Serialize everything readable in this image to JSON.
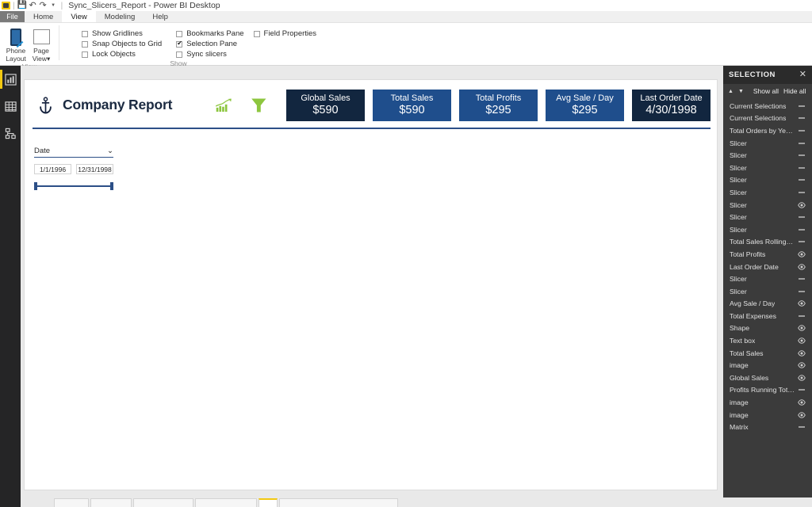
{
  "titlebar": {
    "logo_icon": "powerbi-logo-icon",
    "save_icon": "save-disk-icon",
    "undo_icon": "undo-arrow-icon",
    "redo_icon": "redo-arrow-icon",
    "caret_icon": "chevron-down-icon",
    "separator": "|",
    "title": "Sync_Slicers_Report - Power BI Desktop"
  },
  "ribbon": {
    "tabs": [
      {
        "label": "File",
        "active": false
      },
      {
        "label": "Home",
        "active": false
      },
      {
        "label": "View",
        "active": true
      },
      {
        "label": "Modeling",
        "active": false
      },
      {
        "label": "Help",
        "active": false
      }
    ],
    "groups": [
      {
        "label": "View"
      },
      {
        "label": "Show"
      }
    ],
    "buttons": [
      {
        "label_line1": "Phone",
        "label_line2": "Layout",
        "icon": "phone-layout-icon"
      },
      {
        "label_line1": "Page",
        "label_line2": "View",
        "icon": "page-view-icon",
        "caret": "▾"
      }
    ],
    "checkboxes": [
      {
        "label": "Show Gridlines",
        "checked": false
      },
      {
        "label": "Snap Objects to Grid",
        "checked": false
      },
      {
        "label": "Lock Objects",
        "checked": false
      },
      {
        "label": "Bookmarks Pane",
        "checked": false
      },
      {
        "label": "Selection Pane",
        "checked": true
      },
      {
        "label": "Sync slicers",
        "checked": false
      },
      {
        "label": "Field Properties",
        "checked": false
      }
    ]
  },
  "rail": {
    "items": [
      {
        "icon": "report-view-icon",
        "selected": true
      },
      {
        "icon": "data-view-icon",
        "selected": false
      },
      {
        "icon": "model-view-icon",
        "selected": false
      }
    ]
  },
  "report": {
    "anchor_icon": "anchor-icon",
    "title": "Company Report",
    "growth_icon": "growth-chart-icon",
    "funnel_icon": "funnel-icon",
    "accent_green": "#8dc63f",
    "rule_color": "#2c4f87",
    "cards": [
      {
        "title": "Global Sales",
        "value": "$590",
        "color": "#12263f"
      },
      {
        "title": "Total Sales",
        "value": "$590",
        "color": "#1f4e8c"
      },
      {
        "title": "Total Profits",
        "value": "$295",
        "color": "#1f4e8c"
      },
      {
        "title": "Avg Sale / Day",
        "value": "$295",
        "color": "#1f4e8c"
      },
      {
        "title": "Last Order Date",
        "value": "4/30/1998",
        "color": "#12263f"
      }
    ],
    "slicer": {
      "field": "Date",
      "chevron": "⌄",
      "start_date": "1/1/1996",
      "end_date": "12/31/1998"
    }
  },
  "selection_pane": {
    "title": "SELECTION",
    "close_icon": "close-icon",
    "up_icon": "arrow-up-icon",
    "down_icon": "arrow-down-icon",
    "show_all": "Show all",
    "hide_all": "Hide all",
    "items": [
      {
        "label": "Current Selections",
        "visible": false
      },
      {
        "label": "Current Selections",
        "visible": false
      },
      {
        "label": "Total Orders by Year, Q...",
        "visible": false
      },
      {
        "label": "Slicer",
        "visible": false
      },
      {
        "label": "Slicer",
        "visible": false
      },
      {
        "label": "Slicer",
        "visible": false
      },
      {
        "label": "Slicer",
        "visible": false
      },
      {
        "label": "Slicer",
        "visible": false
      },
      {
        "label": "Slicer",
        "visible": true
      },
      {
        "label": "Slicer",
        "visible": false
      },
      {
        "label": "Slicer",
        "visible": false
      },
      {
        "label": "Total Sales Rolling Aver...",
        "visible": false
      },
      {
        "label": "Total Profits",
        "visible": true
      },
      {
        "label": "Last Order Date",
        "visible": true
      },
      {
        "label": "Slicer",
        "visible": false
      },
      {
        "label": "Slicer",
        "visible": false
      },
      {
        "label": "Avg Sale / Day",
        "visible": true
      },
      {
        "label": "Total Expenses",
        "visible": false
      },
      {
        "label": "Shape",
        "visible": true
      },
      {
        "label": "Text box",
        "visible": true
      },
      {
        "label": "Total Sales",
        "visible": true
      },
      {
        "label": "image",
        "visible": true
      },
      {
        "label": "Global Sales",
        "visible": true
      },
      {
        "label": "Profits Running Total b...",
        "visible": false
      },
      {
        "label": "image",
        "visible": true
      },
      {
        "label": "image",
        "visible": true
      },
      {
        "label": "Matrix",
        "visible": false
      }
    ]
  }
}
